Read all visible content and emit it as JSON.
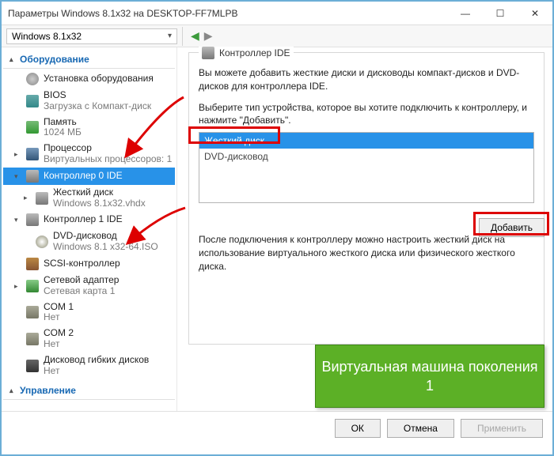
{
  "window": {
    "title": "Параметры Windows 8.1x32 на DESKTOP-FF7MLPB",
    "vm_name": "Windows 8.1x32"
  },
  "sidebar": {
    "hw_header": "Оборудование",
    "nodes": {
      "hw_install": "Установка оборудования",
      "bios": "BIOS",
      "bios_sub": "Загрузка с Компакт-диск",
      "memory": "Память",
      "memory_sub": "1024 МБ",
      "cpu": "Процессор",
      "cpu_sub": "Виртуальных процессоров: 1",
      "ide0": "Контроллер 0 IDE",
      "ide0_hdd": "Жесткий диск",
      "ide0_hdd_sub": "Windows 8.1x32.vhdx",
      "ide1": "Контроллер 1 IDE",
      "ide1_dvd": "DVD-дисковод",
      "ide1_dvd_sub": "Windows 8.1 x32-64.ISO",
      "scsi": "SCSI-контроллер",
      "net": "Сетевой адаптер",
      "net_sub": "Сетевая карта 1",
      "com1": "COM 1",
      "com1_sub": "Нет",
      "com2": "COM 2",
      "com2_sub": "Нет",
      "floppy": "Дисковод гибких дисков",
      "floppy_sub": "Нет"
    },
    "mgmt_header": "Управление"
  },
  "panel": {
    "legend": "Контроллер IDE",
    "desc": "Вы можете добавить жесткие диски и дисководы компакт-дисков и DVD-дисков для контроллера IDE.",
    "desc2": "Выберите тип устройства, которое вы хотите подключить к контроллеру, и нажмите \"Добавить\".",
    "opt_hdd": "Жесткий диск",
    "opt_dvd": "DVD-дисковод",
    "add": "Добавить",
    "hint": "После подключения к контроллеру можно настроить жесткий диск на использование виртуального жесткого диска или физического жесткого диска."
  },
  "callout": "Виртуальная машина поколения 1",
  "buttons": {
    "ok": "ОК",
    "cancel": "Отмена",
    "apply": "Применить"
  }
}
